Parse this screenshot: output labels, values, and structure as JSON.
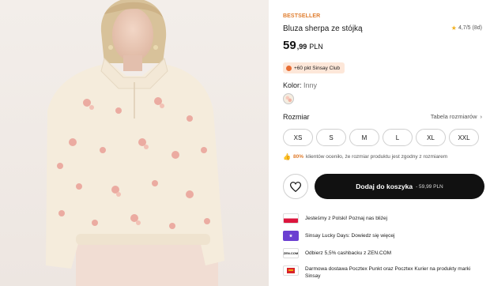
{
  "product": {
    "badge": "BESTSELLER",
    "title": "Bluza sherpa ze stójką",
    "rating_value": "4,7/5",
    "rating_count": "(8d)",
    "price_main": "59",
    "price_decimals": ",99",
    "currency": "PLN",
    "club_text": "+60 pkt Sinsay Club",
    "color_label": "Kolor:",
    "color_value": "Inny"
  },
  "sizes": {
    "label": "Rozmiar",
    "table_link": "Tabela rozmiarów",
    "options": [
      "XS",
      "S",
      "M",
      "L",
      "XL",
      "XXL"
    ]
  },
  "fit": {
    "percent": "80%",
    "text": "klientów oceniło, że rozmiar produktu jest zgodny z rozmiarem"
  },
  "actions": {
    "add_to_cart": "Dodaj do koszyka",
    "add_to_cart_price": "- 59,99 PLN"
  },
  "info": [
    {
      "icon": "poland-flag-icon",
      "text": "Jesteśmy z Polski! Poznaj nas bliżej"
    },
    {
      "icon": "sinsay-lucky-days-icon",
      "text": "Sinsay Lucky Days: Dowiedz się więcej"
    },
    {
      "icon": "zen-logo-icon",
      "icon_text": "ZEN.COM",
      "text": "Odbierz 5,5% cashbacku z ZEN.COM"
    },
    {
      "icon": "poczta-polska-icon",
      "text": "Darmowa dostawa Pocztex Punkt oraz Pocztex Kurier na produkty marki Sinsay"
    }
  ],
  "colors": {
    "accent_orange": "#e07d2e",
    "cart_button": "#111111",
    "club_bg": "#fde7d9",
    "star": "#f2b01e"
  }
}
